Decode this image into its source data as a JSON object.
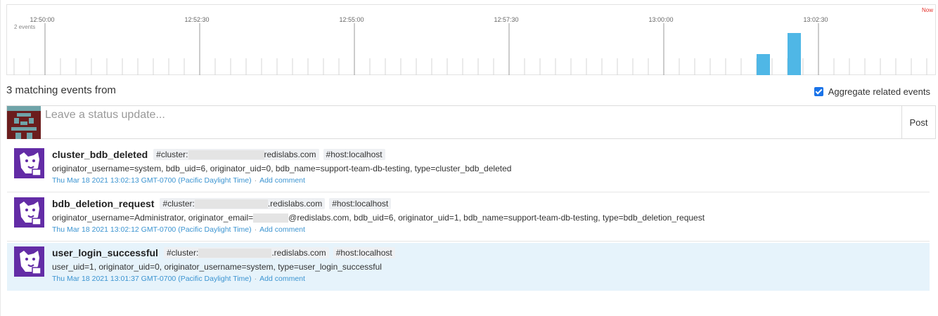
{
  "timeline": {
    "events_label": "2 events",
    "now_label": "Now",
    "time_labels": [
      "12:50:00",
      "12:52:30",
      "12:55:00",
      "12:57:30",
      "13:00:00",
      "13:02:30"
    ],
    "bar_color": "#4fb7e6",
    "bars": [
      {
        "time": "13:01:30",
        "count": 1
      },
      {
        "time": "13:02:00",
        "count": 2
      }
    ]
  },
  "header": {
    "title": "3 matching events from",
    "aggregate_label": "Aggregate related events",
    "aggregate_checked": true
  },
  "status": {
    "placeholder": "Leave a status update...",
    "post_label": "Post"
  },
  "events": [
    {
      "title": "cluster_bdb_deleted",
      "tag_cluster_prefix": "#cluster:",
      "tag_cluster_suffix": "redislabs.com",
      "tag_host": "#host:localhost",
      "body_pre": "originator_username=system, bdb_uid=6, originator_uid=0, bdb_name=support-team-db-testing, type=cluster_bdb_deleted",
      "body_post": "",
      "date": "Thu Mar 18 2021 13:02:13 GMT-0700 (Pacific Daylight Time)",
      "sep": "·",
      "comment": "Add comment"
    },
    {
      "title": "bdb_deletion_request",
      "tag_cluster_prefix": "#cluster:",
      "tag_cluster_suffix": ".redislabs.com",
      "tag_host": "#host:localhost",
      "body_pre": "originator_username=Administrator, originator_email=",
      "body_post": "@redislabs.com, bdb_uid=6, originator_uid=1, bdb_name=support-team-db-testing, type=bdb_deletion_request",
      "date": "Thu Mar 18 2021 13:02:12 GMT-0700 (Pacific Daylight Time)",
      "sep": "·",
      "comment": "Add comment"
    },
    {
      "title": "user_login_successful",
      "tag_cluster_prefix": "#cluster:",
      "tag_cluster_suffix": ".redislabs.com",
      "tag_host": "#host:localhost",
      "body_pre": "user_uid=1, originator_uid=0, originator_username=system, type=user_login_successful",
      "body_post": "",
      "date": "Thu Mar 18 2021 13:01:37 GMT-0700 (Pacific Daylight Time)",
      "sep": "·",
      "comment": "Add comment"
    }
  ]
}
